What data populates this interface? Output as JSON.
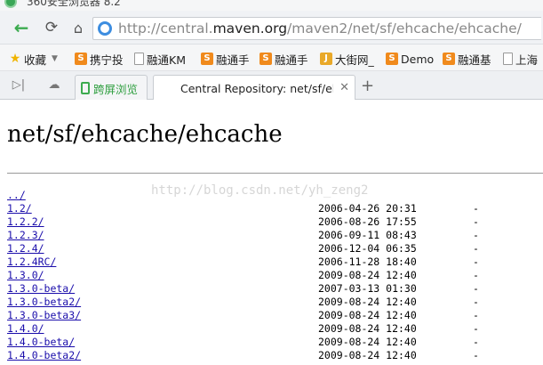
{
  "window": {
    "title": "360安全浏览器 8.2"
  },
  "address_bar": {
    "url_prefix": "http://central.",
    "url_domain": "maven.org",
    "url_path": "/maven2/net/sf/ehcache/ehcache/"
  },
  "bookmarks": [
    {
      "label": "收藏",
      "icon": "star-icon"
    },
    {
      "label": "携宁投",
      "icon": "s-icon"
    },
    {
      "label": "融通KM",
      "icon": "document-icon"
    },
    {
      "label": "融通手",
      "icon": "s-icon"
    },
    {
      "label": "融通手",
      "icon": "s-icon"
    },
    {
      "label": "大街网_",
      "icon": "j-icon"
    },
    {
      "label": "Demo",
      "icon": "s-icon"
    },
    {
      "label": "融通基",
      "icon": "s-icon"
    },
    {
      "label": "上海",
      "icon": "document-icon"
    }
  ],
  "tabs": [
    {
      "label": "跨屏浏览"
    },
    {
      "label": "Central Repository: net/sf/ehcache"
    }
  ],
  "page": {
    "heading": "net/sf/ehcache/ehcache",
    "watermark": "http://blog.csdn.net/yh_zeng2",
    "entries": [
      {
        "name": "../",
        "date": "",
        "size": ""
      },
      {
        "name": "1.2/",
        "date": "2006-04-26 20:31",
        "size": "-"
      },
      {
        "name": "1.2.2/",
        "date": "2006-08-26 17:55",
        "size": "-"
      },
      {
        "name": "1.2.3/",
        "date": "2006-09-11 08:43",
        "size": "-"
      },
      {
        "name": "1.2.4/",
        "date": "2006-12-04 06:35",
        "size": "-"
      },
      {
        "name": "1.2.4RC/",
        "date": "2006-11-28 18:40",
        "size": "-"
      },
      {
        "name": "1.3.0/",
        "date": "2009-08-24 12:40",
        "size": "-"
      },
      {
        "name": "1.3.0-beta/",
        "date": "2007-03-13 01:30",
        "size": "-"
      },
      {
        "name": "1.3.0-beta2/",
        "date": "2009-08-24 12:40",
        "size": "-"
      },
      {
        "name": "1.3.0-beta3/",
        "date": "2009-08-24 12:40",
        "size": "-"
      },
      {
        "name": "1.4.0/",
        "date": "2009-08-24 12:40",
        "size": "-"
      },
      {
        "name": "1.4.0-beta/",
        "date": "2009-08-24 12:40",
        "size": "-"
      },
      {
        "name": "1.4.0-beta2/",
        "date": "2009-08-24 12:40",
        "size": "-"
      }
    ]
  }
}
